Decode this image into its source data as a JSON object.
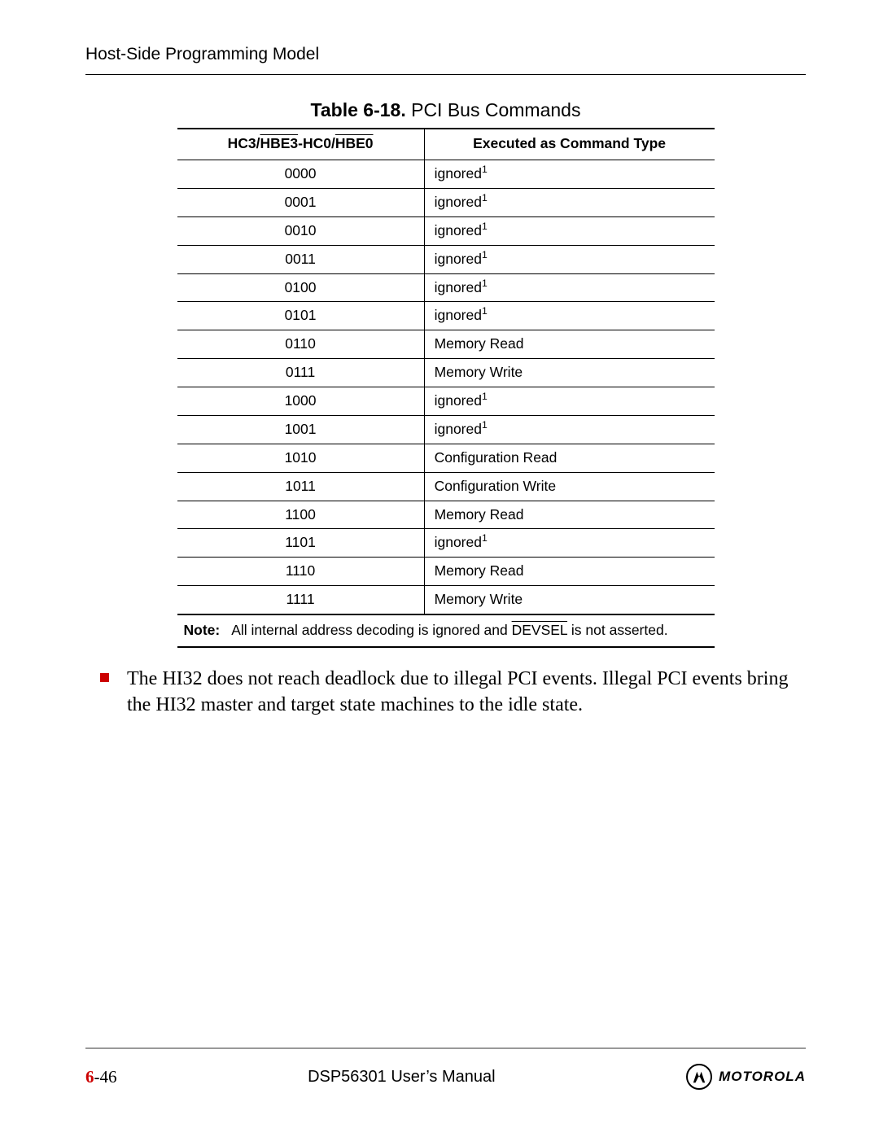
{
  "header": {
    "running_head": "Host-Side Programming Model"
  },
  "table": {
    "caption_bold": "Table 6-18.",
    "caption_rest": " PCI Bus Commands",
    "col1_full": "HC3/HBE3-HC0/HBE0",
    "col1_a": "HC3/",
    "col1_b": "HBE3",
    "col1_c": "-HC0/",
    "col1_d": "HBE0",
    "col2": "Executed as Command Type",
    "rows": [
      {
        "code": "0000",
        "cmd": "ignored",
        "sup": "1"
      },
      {
        "code": "0001",
        "cmd": "ignored",
        "sup": "1"
      },
      {
        "code": "0010",
        "cmd": "ignored",
        "sup": "1"
      },
      {
        "code": "0011",
        "cmd": "ignored",
        "sup": "1"
      },
      {
        "code": "0100",
        "cmd": "ignored",
        "sup": "1"
      },
      {
        "code": "0101",
        "cmd": "ignored",
        "sup": "1"
      },
      {
        "code": "0110",
        "cmd": "Memory Read",
        "sup": ""
      },
      {
        "code": "0111",
        "cmd": "Memory Write",
        "sup": ""
      },
      {
        "code": "1000",
        "cmd": "ignored",
        "sup": "1"
      },
      {
        "code": "1001",
        "cmd": "ignored",
        "sup": "1"
      },
      {
        "code": "1010",
        "cmd": "Configuration Read",
        "sup": ""
      },
      {
        "code": "1011",
        "cmd": "Configuration Write",
        "sup": ""
      },
      {
        "code": "1100",
        "cmd": "Memory Read",
        "sup": ""
      },
      {
        "code": "1101",
        "cmd": "ignored",
        "sup": "1"
      },
      {
        "code": "1110",
        "cmd": "Memory Read",
        "sup": ""
      },
      {
        "code": "1111",
        "cmd": "Memory Write",
        "sup": ""
      }
    ],
    "note_label": "Note:",
    "note_a": "All internal address decoding is ignored and ",
    "note_b": "DEVSEL",
    "note_c": " is not asserted."
  },
  "bullet": {
    "text": "The HI32 does not reach deadlock due to illegal PCI events. Illegal PCI events bring the HI32 master and target state machines to the idle state."
  },
  "footer": {
    "page_ch": "6",
    "page_dash": "-46",
    "doc_title": "DSP56301 User’s Manual",
    "brand": "MOTOROLA"
  },
  "chart_data": {
    "type": "table",
    "title": "Table 6-18. PCI Bus Commands",
    "columns": [
      "HC3/HBE3-HC0/HBE0",
      "Executed as Command Type"
    ],
    "rows": [
      [
        "0000",
        "ignored"
      ],
      [
        "0001",
        "ignored"
      ],
      [
        "0010",
        "ignored"
      ],
      [
        "0011",
        "ignored"
      ],
      [
        "0100",
        "ignored"
      ],
      [
        "0101",
        "ignored"
      ],
      [
        "0110",
        "Memory Read"
      ],
      [
        "0111",
        "Memory Write"
      ],
      [
        "1000",
        "ignored"
      ],
      [
        "1001",
        "ignored"
      ],
      [
        "1010",
        "Configuration Read"
      ],
      [
        "1011",
        "Configuration Write"
      ],
      [
        "1100",
        "Memory Read"
      ],
      [
        "1101",
        "ignored"
      ],
      [
        "1110",
        "Memory Read"
      ],
      [
        "1111",
        "Memory Write"
      ]
    ],
    "note": "All internal address decoding is ignored and DEVSEL is not asserted."
  }
}
